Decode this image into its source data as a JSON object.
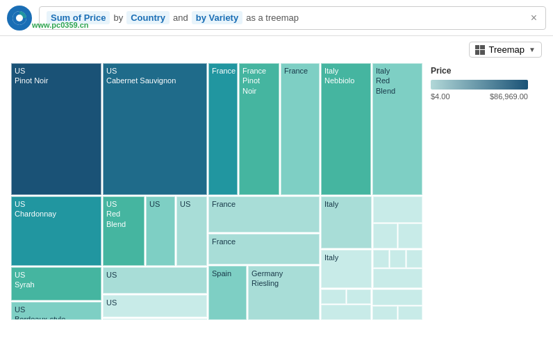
{
  "header": {
    "search_parts": [
      {
        "type": "pill",
        "text": "Sum of Price"
      },
      {
        "type": "text",
        "text": "by"
      },
      {
        "type": "pill",
        "text": "Country"
      },
      {
        "type": "text",
        "text": "and"
      },
      {
        "type": "pill",
        "text": "by Variety"
      },
      {
        "type": "text",
        "text": "as a treemap"
      }
    ],
    "close_label": "×"
  },
  "toolbar": {
    "chart_type": "Treemap",
    "chart_type_icon": "treemap-icon"
  },
  "legend": {
    "title": "Price",
    "min_label": "$4.00",
    "max_label": "$86,969.00"
  },
  "treemap": {
    "cells": [
      {
        "id": "us-pinot-noir",
        "label": "US\nPinot Noir",
        "color": "dark-blue",
        "width": "19%",
        "height": "55%"
      },
      {
        "id": "us-cab-sauv",
        "label": "US\nCabernet Sauvignon",
        "color": "med-blue",
        "width": "22%",
        "height": "55%"
      },
      {
        "id": "france-col",
        "label": "France sections"
      },
      {
        "id": "italy-col",
        "label": "Italy sections"
      },
      {
        "id": "us-chardonnay",
        "label": "US\nChardonnay",
        "color": "teal-blue"
      },
      {
        "id": "us-red-blend",
        "label": "US\nRed\nBlend",
        "color": "teal"
      },
      {
        "id": "germany-riesling",
        "label": "Germany\nRiesling",
        "color": "lighter-teal"
      }
    ]
  },
  "website": "www.pc0359.cn"
}
